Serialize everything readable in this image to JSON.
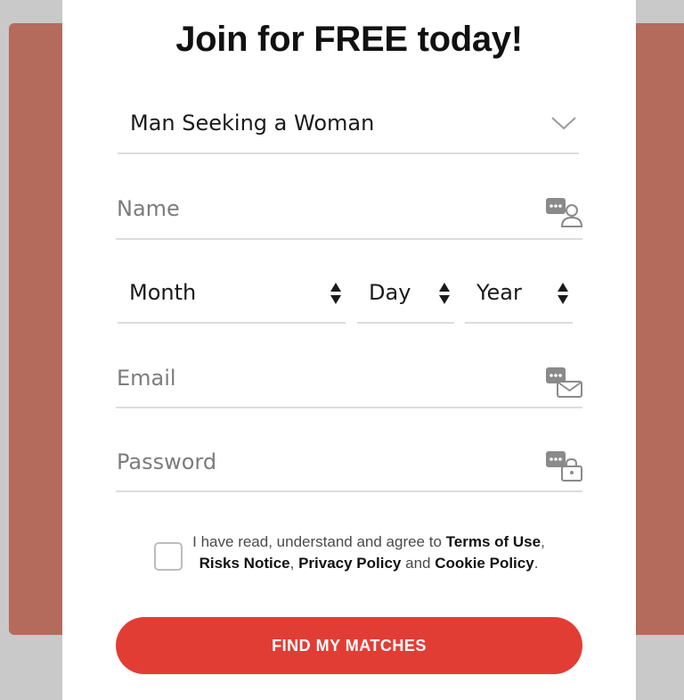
{
  "form": {
    "title": "Join for FREE today!",
    "seeking_select": {
      "value": "Man Seeking a Woman",
      "icon": "chevron-down-icon"
    },
    "name_field": {
      "placeholder": "Name",
      "icon": "name-card-icon"
    },
    "birth_month": {
      "value": "Month",
      "icon": "up-down-arrows-icon"
    },
    "birth_day": {
      "value": "Day",
      "icon": "up-down-arrows-icon"
    },
    "birth_year": {
      "value": "Year",
      "icon": "up-down-arrows-icon"
    },
    "email_field": {
      "placeholder": "Email",
      "icon": "email-card-icon"
    },
    "password_field": {
      "placeholder": "Password",
      "icon": "lock-card-icon"
    },
    "terms": {
      "prefix": "I have read, understand and agree to ",
      "terms_of_use": "Terms of Use",
      "sep1": ", ",
      "risks_notice": "Risks Notice",
      "sep2": ", ",
      "privacy_policy": "Privacy Policy",
      "sep3": " and ",
      "cookie_policy": "Cookie Policy",
      "suffix": ".",
      "checked": false
    },
    "submit_label": "FIND MY MATCHES"
  },
  "colors": {
    "backdrop": "#b56b5c",
    "card": "#ffffff",
    "accent": "#e23d35",
    "icon_gray": "#8a8a8a"
  }
}
